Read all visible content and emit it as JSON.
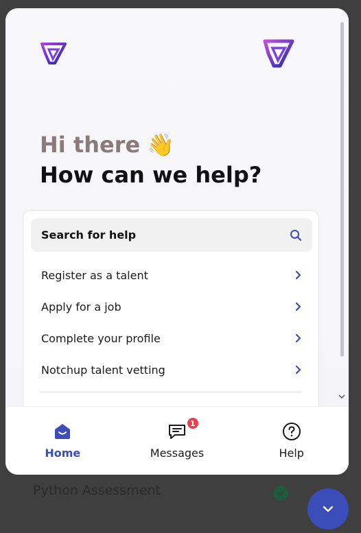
{
  "background": {
    "item_label": "Python Assessment"
  },
  "widget": {
    "greeting": "Hi there",
    "greeting_emoji": "👋",
    "headline": "How can we help?",
    "search": {
      "label": "Search for help",
      "icon": "search-icon"
    },
    "help_links": [
      {
        "label": "Register as a talent"
      },
      {
        "label": "Apply for a job"
      },
      {
        "label": "Complete your profile"
      },
      {
        "label": "Notchup talent vetting"
      }
    ],
    "tabs": [
      {
        "label": "Home",
        "icon": "home-icon",
        "active": true
      },
      {
        "label": "Messages",
        "icon": "messages-icon",
        "badge": "1"
      },
      {
        "label": "Help",
        "icon": "help-icon"
      }
    ]
  },
  "colors": {
    "accent": "#3a4db8",
    "badge": "#e8404a",
    "logo_purple": "#7b3fe4",
    "logo_navy": "#1a2ba8"
  }
}
